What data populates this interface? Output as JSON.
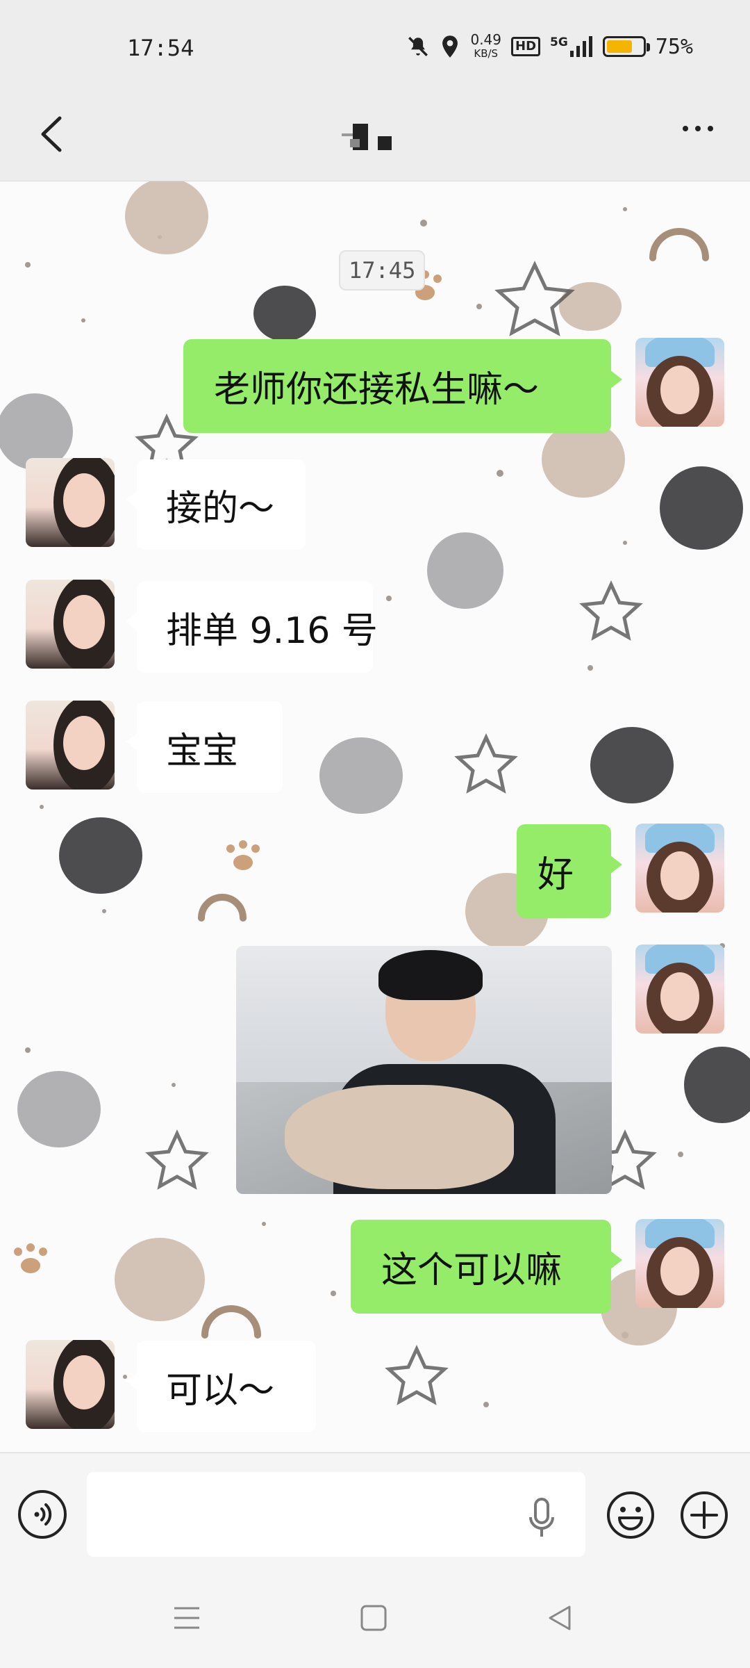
{
  "status_bar": {
    "time": "17:54",
    "net_speed_value": "0.49",
    "net_speed_unit": "KB/S",
    "hd_label": "HD",
    "network_label": "5G",
    "battery_percent": "75%",
    "battery_level": 0.75,
    "icons": [
      "mute-icon",
      "location-icon",
      "signal-icon",
      "battery-icon"
    ]
  },
  "header": {
    "back_icon": "chevron-left-icon",
    "more_icon": "more-dots-icon"
  },
  "chat": {
    "timestamp": "17:45",
    "messages": [
      {
        "sender": "self",
        "type": "text",
        "text": "老师你还接私生嘛～"
      },
      {
        "sender": "other",
        "type": "text",
        "text": "接的～"
      },
      {
        "sender": "other",
        "type": "text",
        "text": "排单 9.16 号"
      },
      {
        "sender": "other",
        "type": "text",
        "text": "宝宝"
      },
      {
        "sender": "self",
        "type": "text",
        "text": "好"
      },
      {
        "sender": "self",
        "type": "image",
        "text": ""
      },
      {
        "sender": "self",
        "type": "text",
        "text": "这个可以嘛"
      },
      {
        "sender": "other",
        "type": "text",
        "text": "可以～"
      }
    ]
  },
  "input_bar": {
    "placeholder": "",
    "icons": [
      "voice-icon",
      "mic-icon",
      "emoji-icon",
      "plus-icon"
    ]
  },
  "system_nav": {
    "icons": [
      "menu-icon",
      "home-icon",
      "back-triangle-icon"
    ]
  },
  "colors": {
    "self_bubble": "#95ec69",
    "other_bubble": "#ffffff",
    "background": "#ededed",
    "battery": "#f4b400"
  }
}
